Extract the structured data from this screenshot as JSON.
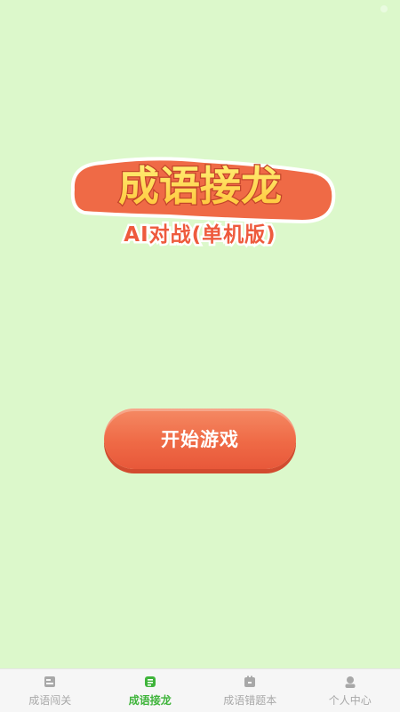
{
  "app": {
    "title": "成语接龙",
    "subtitle": "AI对战(单机版)"
  },
  "main": {
    "start_button": "开始游戏"
  },
  "tabbar": {
    "items": [
      {
        "label": "成语闯关",
        "icon": "book-icon",
        "active": false
      },
      {
        "label": "成语接龙",
        "icon": "chat-icon",
        "active": true
      },
      {
        "label": "成语错题本",
        "icon": "notebook-icon",
        "active": false
      },
      {
        "label": "个人中心",
        "icon": "user-icon",
        "active": false
      }
    ],
    "active_color": "#3fb43b",
    "inactive_color": "#a8a8a8"
  },
  "colors": {
    "background": "#dcf8cb",
    "accent": "#ef6a46",
    "title_fill": "#ffd84d"
  }
}
